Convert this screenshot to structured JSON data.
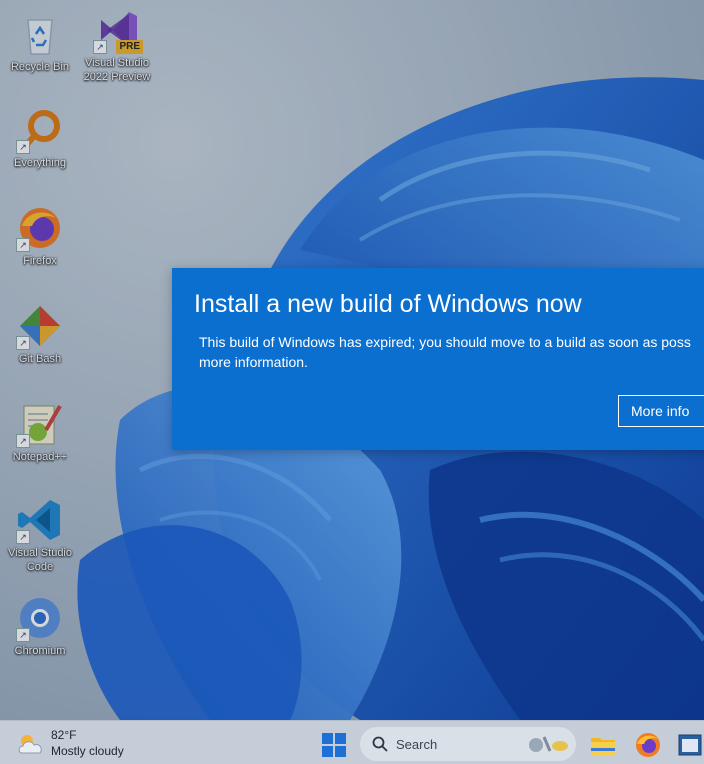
{
  "desktop": {
    "icons": [
      {
        "label": "Recycle Bin",
        "icon": "recycle-bin-icon"
      },
      {
        "label": "Visual Studio 2022 Preview",
        "icon": "visual-studio-icon",
        "badge": "PRE"
      },
      {
        "label": "Everything",
        "icon": "everything-search-icon"
      },
      {
        "label": "Firefox",
        "icon": "firefox-icon"
      },
      {
        "label": "Git Bash",
        "icon": "git-bash-icon"
      },
      {
        "label": "Notepad++",
        "icon": "notepad-plus-plus-icon"
      },
      {
        "label": "Visual Studio Code",
        "icon": "vscode-icon"
      },
      {
        "label": "Chromium",
        "icon": "chromium-icon"
      }
    ],
    "shortcut_glyph": "↗"
  },
  "dialog": {
    "title": "Install a new build of Windows now",
    "body_line1": "This build of Windows has expired; you should move to a build as soon as poss",
    "body_line2": "more information.",
    "button": "More info",
    "color": "#0a6fcf"
  },
  "taskbar": {
    "weather_temp": "82°F",
    "weather_desc": "Mostly cloudy",
    "search_placeholder": "Search",
    "apps": [
      "file-explorer-icon",
      "firefox-icon",
      "app-window-icon"
    ]
  }
}
